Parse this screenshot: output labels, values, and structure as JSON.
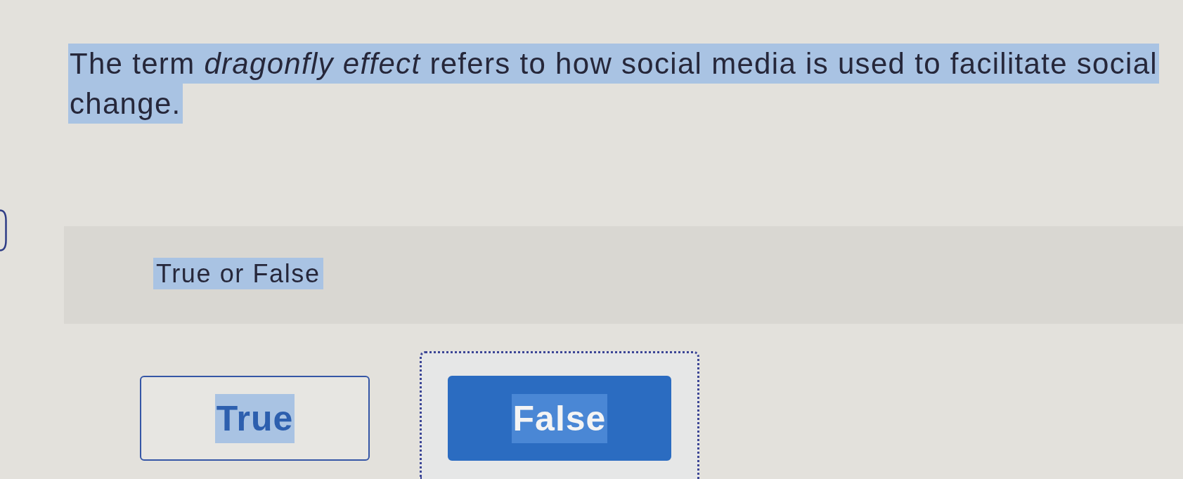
{
  "question": {
    "text": "The term *dragonfly effect* refers to how social media is used to facilitate social change.",
    "highlighted": true
  },
  "prompt": {
    "text": "True or False",
    "highlighted": true
  },
  "options": [
    {
      "label": "True",
      "selected": false,
      "highlighted": true,
      "focused": false
    },
    {
      "label": "False",
      "selected": true,
      "highlighted": true,
      "focused": true
    }
  ]
}
